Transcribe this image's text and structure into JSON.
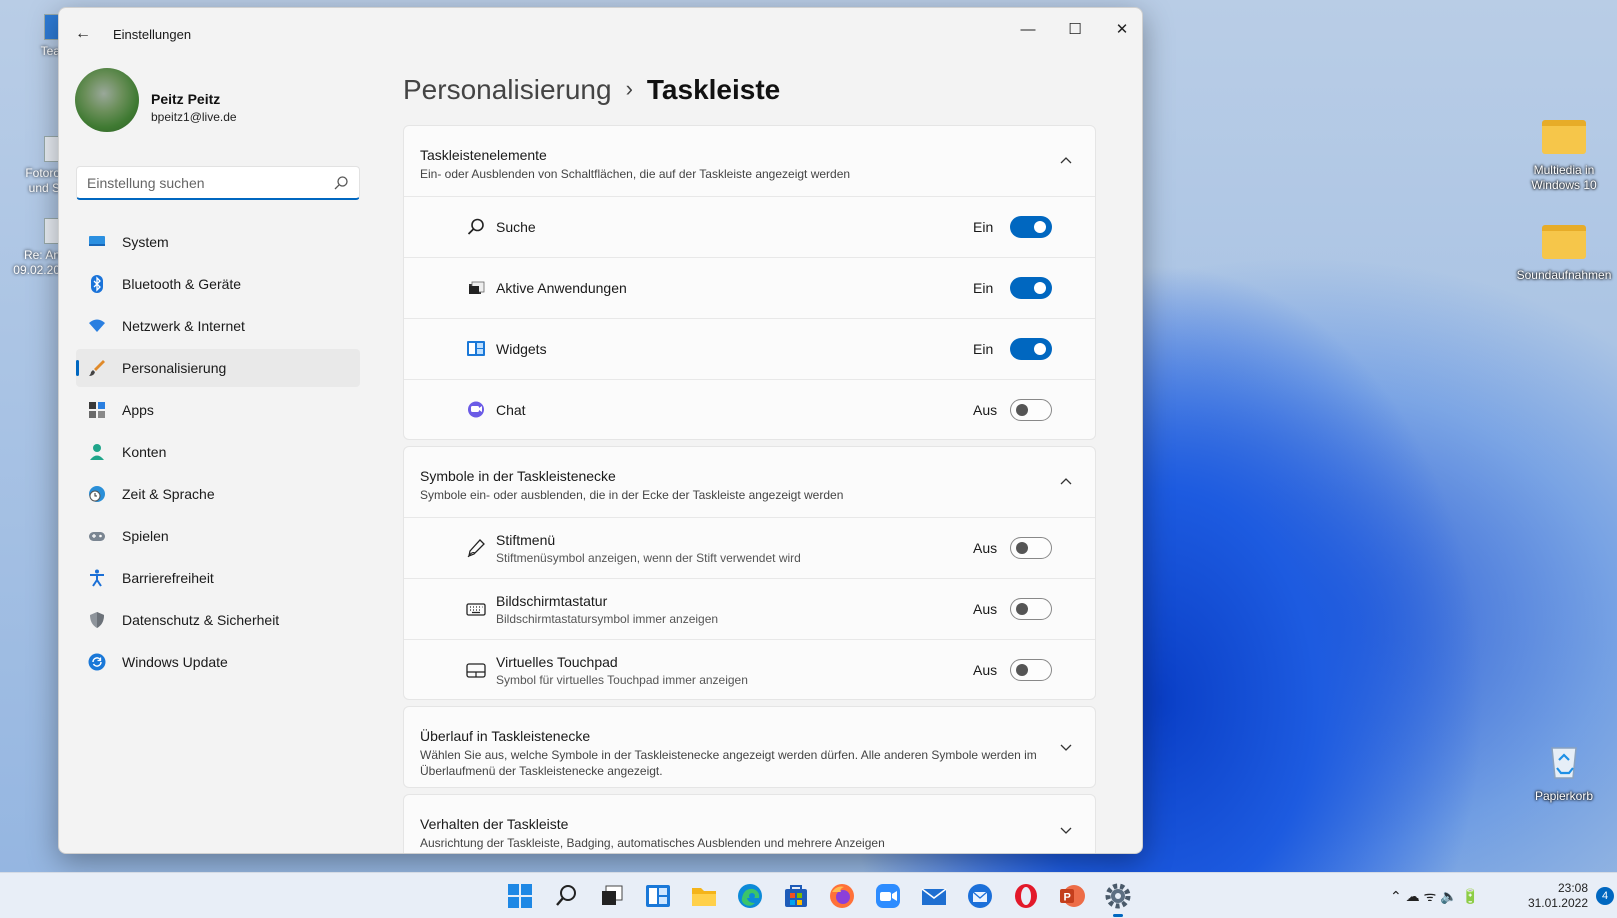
{
  "window": {
    "app_title": "Einstellungen",
    "back_glyph": "←",
    "min_glyph": "—",
    "max_glyph": "☐",
    "close_glyph": "✕"
  },
  "profile": {
    "name": "Peitz Peitz",
    "email": "bpeitz1@live.de"
  },
  "search": {
    "placeholder": "Einstellung suchen",
    "value": ""
  },
  "nav": {
    "items": [
      {
        "label": "System",
        "icon": "monitor-icon"
      },
      {
        "label": "Bluetooth & Geräte",
        "icon": "bluetooth-icon"
      },
      {
        "label": "Netzwerk & Internet",
        "icon": "wifi-icon"
      },
      {
        "label": "Personalisierung",
        "icon": "brush-icon",
        "active": true
      },
      {
        "label": "Apps",
        "icon": "apps-icon"
      },
      {
        "label": "Konten",
        "icon": "person-icon"
      },
      {
        "label": "Zeit & Sprache",
        "icon": "clock-globe-icon"
      },
      {
        "label": "Spielen",
        "icon": "gamepad-icon"
      },
      {
        "label": "Barrierefreiheit",
        "icon": "accessibility-icon"
      },
      {
        "label": "Datenschutz & Sicherheit",
        "icon": "shield-icon"
      },
      {
        "label": "Windows Update",
        "icon": "update-icon"
      }
    ]
  },
  "breadcrumb": {
    "parent": "Personalisierung",
    "separator": "›",
    "current": "Taskleiste"
  },
  "sections": [
    {
      "title": "Taskleistenelemente",
      "subtitle": "Ein- oder Ausblenden von Schaltflächen, die auf der Taskleiste angezeigt werden",
      "expanded": true,
      "rows": [
        {
          "label": "Suche",
          "state": "Ein",
          "on": true,
          "icon": "search-icon"
        },
        {
          "label": "Aktive Anwendungen",
          "state": "Ein",
          "on": true,
          "icon": "task-view-icon"
        },
        {
          "label": "Widgets",
          "state": "Ein",
          "on": true,
          "icon": "widgets-icon"
        },
        {
          "label": "Chat",
          "state": "Aus",
          "on": false,
          "icon": "chat-icon"
        }
      ]
    },
    {
      "title": "Symbole in der Taskleistenecke",
      "subtitle": "Symbole ein- oder ausblenden, die in der Ecke der Taskleiste angezeigt werden",
      "expanded": true,
      "rows": [
        {
          "label": "Stiftmenü",
          "sub": "Stiftmenüsymbol anzeigen, wenn der Stift verwendet wird",
          "state": "Aus",
          "on": false,
          "icon": "pen-icon"
        },
        {
          "label": "Bildschirmtastatur",
          "sub": "Bildschirmtastatursymbol immer anzeigen",
          "state": "Aus",
          "on": false,
          "icon": "keyboard-icon"
        },
        {
          "label": "Virtuelles Touchpad",
          "sub": "Symbol für virtuelles Touchpad immer anzeigen",
          "state": "Aus",
          "on": false,
          "icon": "touchpad-icon"
        }
      ]
    },
    {
      "title": "Überlauf in Taskleistenecke",
      "subtitle": "Wählen Sie aus, welche Symbole in der Taskleistenecke angezeigt werden dürfen. Alle anderen Symbole werden im Überlaufmenü der Taskleistenecke angezeigt.",
      "expanded": false
    },
    {
      "title": "Verhalten der Taskleiste",
      "subtitle": "Ausrichtung der Taskleiste, Badging, automatisches Ausblenden und mehrere Anzeigen",
      "expanded": false
    }
  ],
  "desktop": {
    "right_icons": [
      {
        "label": "Multiedia in Windows 10",
        "icon": "folder-icon"
      },
      {
        "label": "Soundaufnahmen",
        "icon": "folder-icon"
      },
      {
        "label": "Papierkorb",
        "icon": "recycle-bin-icon"
      }
    ],
    "left_icons": [
      {
        "label": "Tea"
      },
      {
        "label": "Fotoro und S"
      },
      {
        "label": "Re: An 09.02.20"
      }
    ]
  },
  "taskbar": {
    "apps": [
      "start-icon",
      "search-icon",
      "task-view-icon",
      "widgets-icon",
      "explorer-icon",
      "edge-icon",
      "store-icon",
      "firefox-icon",
      "zoom-icon",
      "mail-icon",
      "thunderbird-icon",
      "opera-icon",
      "powerpoint-icon",
      "settings-icon"
    ],
    "tray_glyphs": "⌃  ☁  ᯤ  🔈  🔋",
    "time": "23:08",
    "date": "31.01.2022",
    "notifications": "4"
  }
}
